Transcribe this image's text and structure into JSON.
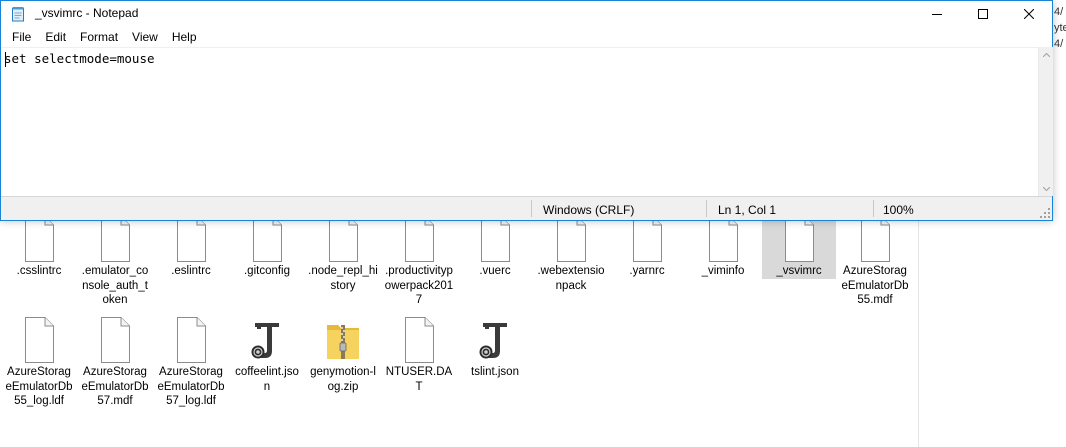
{
  "notepad": {
    "title": "_vsvimrc - Notepad",
    "menu": [
      "File",
      "Edit",
      "Format",
      "View",
      "Help"
    ],
    "content": "set selectmode=mouse",
    "status": {
      "line_ending": "Windows (CRLF)",
      "position": "Ln 1, Col 1",
      "zoom": "100%"
    }
  },
  "explorer": {
    "files_row1": [
      {
        "name": ".csslintrc",
        "icon": "document-icon"
      },
      {
        "name": ".emulator_console_auth_token",
        "icon": "document-icon"
      },
      {
        "name": ".eslintrc",
        "icon": "document-icon"
      },
      {
        "name": ".gitconfig",
        "icon": "document-icon"
      },
      {
        "name": ".node_repl_history",
        "icon": "document-icon"
      },
      {
        "name": ".productivitypowerpack2017",
        "icon": "document-icon"
      },
      {
        "name": ".vuerc",
        "icon": "document-icon"
      },
      {
        "name": ".webextensionpack",
        "icon": "document-icon"
      },
      {
        "name": ".yarnrc",
        "icon": "document-icon"
      },
      {
        "name": "_viminfo",
        "icon": "document-icon"
      },
      {
        "name": "_vsvimrc",
        "icon": "document-icon",
        "selected": true
      },
      {
        "name": "AzureStorageEmulatorDb55.mdf",
        "icon": "document-icon"
      }
    ],
    "files_row2": [
      {
        "name": "AzureStorageEmulatorDb55_log.ldf",
        "icon": "document-icon"
      },
      {
        "name": "AzureStorageEmulatorDb57.mdf",
        "icon": "document-icon"
      },
      {
        "name": "AzureStorageEmulatorDb57_log.ldf",
        "icon": "document-icon"
      },
      {
        "name": "coffeelint.json",
        "icon": "json-icon"
      },
      {
        "name": "genymotion-log.zip",
        "icon": "zip-folder-icon"
      },
      {
        "name": "NTUSER.DAT",
        "icon": "document-icon"
      },
      {
        "name": "tslint.json",
        "icon": "json-icon"
      }
    ],
    "behind_fragments": [
      "4/",
      "yte",
      "4/"
    ]
  },
  "colors": {
    "window_border": "#1883d7",
    "selection": "#d9d9d9",
    "statusbar": "#f0f0f0"
  }
}
